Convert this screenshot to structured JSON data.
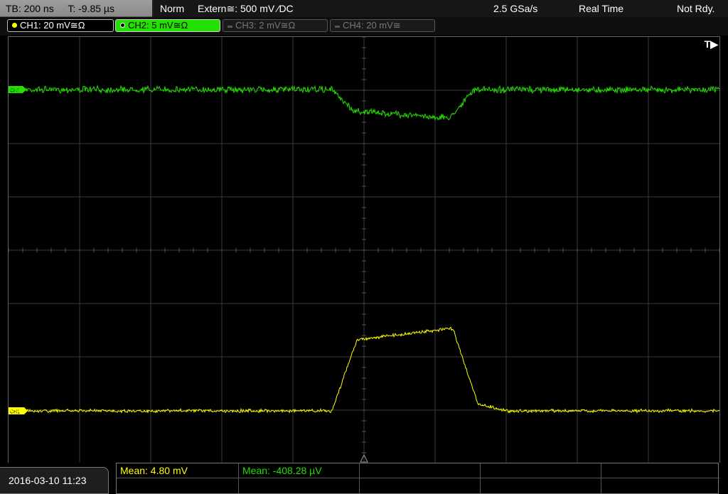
{
  "header": {
    "timebase": "TB: 200 ns",
    "trigger_time": "T: -9.85 µs",
    "trigger_mode": "Norm",
    "trigger_source": "Extern≅: 500 mV ⁄DC",
    "sample_rate": "2.5 GSa/s",
    "acq_mode": "Real Time",
    "status": "Not Rdy."
  },
  "channels": [
    {
      "label": "CH1: 20 mV≅Ω",
      "color": "#ffff00",
      "active": true
    },
    {
      "label": "CH2: 5 mV≅Ω",
      "color": "#22e000",
      "active": true,
      "selected": true
    },
    {
      "label": "CH3: 2 mV≅Ω",
      "color": "#777777",
      "active": false
    },
    {
      "label": "CH4: 20 mV≅",
      "color": "#777777",
      "active": false
    }
  ],
  "screen": {
    "trigger_marker": "T▶",
    "ch1_marker": "CH1",
    "ch2_marker": "CH2"
  },
  "footer": {
    "datetime": "2016-03-10 11:23",
    "measurements": [
      {
        "label": "Mean: 4.80 mV",
        "color": "#ffff00"
      },
      {
        "label": "Mean: -408.28 µV",
        "color": "#22e000"
      }
    ]
  }
}
